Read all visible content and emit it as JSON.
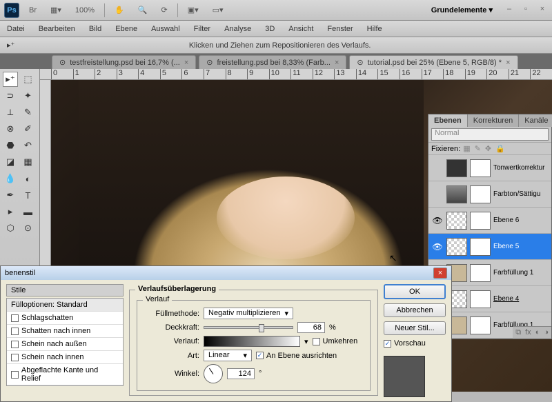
{
  "top": {
    "ps": "Ps",
    "br": "Br",
    "zoom": "100%",
    "workspace": "Grundelemente ▾"
  },
  "menu": {
    "items": [
      "Datei",
      "Bearbeiten",
      "Bild",
      "Ebene",
      "Auswahl",
      "Filter",
      "Analyse",
      "3D",
      "Ansicht",
      "Fenster",
      "Hilfe"
    ]
  },
  "options": {
    "hint": "Klicken und Ziehen zum Repositionieren des Verlaufs."
  },
  "tabs": [
    {
      "label": "testfreistellung.psd bei 16,7% (..."
    },
    {
      "label": "freistellung.psd bei 8,33% (Farb..."
    },
    {
      "label": "tutorial.psd bei 25% (Ebene 5, RGB/8) *"
    }
  ],
  "ruler_marks": [
    "0",
    "1",
    "2",
    "3",
    "4",
    "5",
    "6",
    "7",
    "8",
    "9",
    "10",
    "11",
    "12",
    "13",
    "14",
    "15",
    "16",
    "17",
    "18",
    "19",
    "20",
    "21",
    "22"
  ],
  "panel": {
    "tabs": [
      "Ebenen",
      "Korrekturen",
      "Kanäle"
    ],
    "blend": "Normal",
    "lock_label": "Fixieren:",
    "layers": [
      {
        "name": "Tonwertkorrektur",
        "vis": ""
      },
      {
        "name": "Farbton/Sättigu",
        "vis": ""
      },
      {
        "name": "Ebene 6",
        "vis": "👁"
      },
      {
        "name": "Ebene 5",
        "vis": "👁",
        "sel": true
      },
      {
        "name": "Farbfüllung 1",
        "vis": ""
      },
      {
        "name": "Ebene 4",
        "vis": ""
      },
      {
        "name": "Farbfüllung 1",
        "vis": ""
      }
    ]
  },
  "dialog": {
    "title": "benenstil",
    "left_hdr": "Stile",
    "fill_opt": "Fülloptionen: Standard",
    "styles": [
      "Schlagschatten",
      "Schatten nach innen",
      "Schein nach außen",
      "Schein nach innen",
      "Abgeflachte Kante und Relief"
    ],
    "group": "Verlaufsüberlagerung",
    "subgroup": "Verlauf",
    "fillmode_label": "Füllmethode:",
    "fillmode": "Negativ multiplizieren",
    "opacity_label": "Deckkraft:",
    "opacity": "68",
    "pct": "%",
    "gradient_label": "Verlauf:",
    "reverse": "Umkehren",
    "type_label": "Art:",
    "type": "Linear",
    "align": "An Ebene ausrichten",
    "angle_label": "Winkel:",
    "angle": "124",
    "deg": "°",
    "ok": "OK",
    "cancel": "Abbrechen",
    "new_style": "Neuer Stil...",
    "preview": "Vorschau"
  }
}
